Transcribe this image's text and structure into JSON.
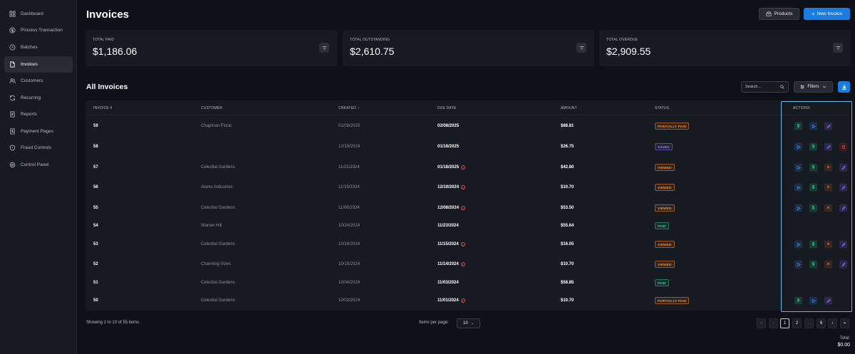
{
  "sidebar": {
    "items": [
      {
        "label": "Dashboard",
        "icon": "dashboard-icon"
      },
      {
        "label": "Process Transaction",
        "icon": "dollar-circle-icon"
      },
      {
        "label": "Batches",
        "icon": "history-icon"
      },
      {
        "label": "Invoices",
        "icon": "document-icon",
        "active": true
      },
      {
        "label": "Customers",
        "icon": "users-icon"
      },
      {
        "label": "Recurring",
        "icon": "refresh-icon"
      },
      {
        "label": "Reports",
        "icon": "report-icon"
      },
      {
        "label": "Payment Pages",
        "icon": "payment-page-icon"
      },
      {
        "label": "Fraud Controls",
        "icon": "shield-icon"
      },
      {
        "label": "Control Panel",
        "icon": "gear-icon"
      }
    ]
  },
  "header": {
    "title": "Invoices",
    "products_label": "Products",
    "new_invoice_label": "New Invoice"
  },
  "stats": [
    {
      "label": "TOTAL PAID",
      "value": "$1,186.06"
    },
    {
      "label": "TOTAL OUTSTANDING",
      "value": "$2,610.75"
    },
    {
      "label": "TOTAL OVERDUE",
      "value": "$2,909.55"
    }
  ],
  "section": {
    "title": "All Invoices",
    "search_placeholder": "Search...",
    "filters_label": "Filters"
  },
  "table": {
    "columns": {
      "invoice": "INVOICE #",
      "customer": "CUSTOMER",
      "created": "CREATED",
      "due": "DUE DATE",
      "amount": "AMOUNT",
      "status": "STATUS",
      "actions": "ACTIONS"
    },
    "rows": [
      {
        "invoice": "59",
        "customer": "Chapman Floral",
        "created": "01/09/2025",
        "due": "02/08/2025",
        "overdue": false,
        "amount": "$88.81",
        "status": "PARTIALLY PAID",
        "status_color": "orange",
        "actions": [
          "pay",
          "send",
          "edit"
        ]
      },
      {
        "invoice": "58",
        "customer": "",
        "created": "12/19/2024",
        "due": "01/18/2025",
        "overdue": false,
        "amount": "$26.75",
        "status": "SAVED",
        "status_color": "purple",
        "actions": [
          "send",
          "pay",
          "edit",
          "delete"
        ]
      },
      {
        "invoice": "57",
        "customer": "Celestial Gardens",
        "created": "11/22/2024",
        "due": "01/18/2025",
        "overdue": true,
        "amount": "$42.80",
        "status": "VIEWED",
        "status_color": "orange",
        "actions": [
          "send",
          "pay",
          "cancel",
          "edit"
        ]
      },
      {
        "invoice": "56",
        "customer": "Alamo Industries",
        "created": "11/19/2024",
        "due": "12/19/2024",
        "overdue": true,
        "amount": "$10.70",
        "status": "VIEWED",
        "status_color": "orange",
        "actions": [
          "send",
          "pay",
          "cancel",
          "edit"
        ]
      },
      {
        "invoice": "55",
        "customer": "Celestial Gardens",
        "created": "11/08/2024",
        "due": "12/08/2024",
        "overdue": true,
        "amount": "$53.50",
        "status": "VIEWED",
        "status_color": "orange",
        "actions": [
          "send",
          "pay",
          "cancel",
          "edit"
        ]
      },
      {
        "invoice": "54",
        "customer": "Warren Hill",
        "created": "10/24/2024",
        "due": "11/23/2024",
        "overdue": false,
        "amount": "$55.64",
        "status": "PAID",
        "status_color": "green",
        "actions": []
      },
      {
        "invoice": "53",
        "customer": "Celestial Gardens",
        "created": "10/16/2024",
        "due": "11/15/2024",
        "overdue": true,
        "amount": "$16.05",
        "status": "VIEWED",
        "status_color": "orange",
        "actions": [
          "send",
          "pay",
          "cancel",
          "edit"
        ]
      },
      {
        "invoice": "52",
        "customer": "Charming Vows",
        "created": "10/15/2024",
        "due": "11/14/2024",
        "overdue": true,
        "amount": "$10.70",
        "status": "VIEWED",
        "status_color": "orange",
        "actions": [
          "send",
          "pay",
          "cancel",
          "edit"
        ]
      },
      {
        "invoice": "51",
        "customer": "Celestial Gardens",
        "created": "10/04/2024",
        "due": "11/03/2024",
        "overdue": false,
        "amount": "$58.85",
        "status": "PAID",
        "status_color": "green",
        "actions": []
      },
      {
        "invoice": "50",
        "customer": "Celestial Gardens",
        "created": "10/02/2024",
        "due": "11/01/2024",
        "overdue": true,
        "amount": "$10.70",
        "status": "PARTIALLY PAID",
        "status_color": "orange",
        "actions": [
          "pay",
          "send",
          "edit"
        ]
      }
    ]
  },
  "footer": {
    "showing": "Showing 1 to 10 of 55 items",
    "items_per_page_label": "Items per page:",
    "items_per_page_value": "10",
    "pages": [
      "«",
      "‹",
      "1",
      "2",
      "...",
      "6",
      "›",
      "»"
    ],
    "current_page": "1",
    "total_label": "Total:",
    "total_value": "$0.00"
  }
}
